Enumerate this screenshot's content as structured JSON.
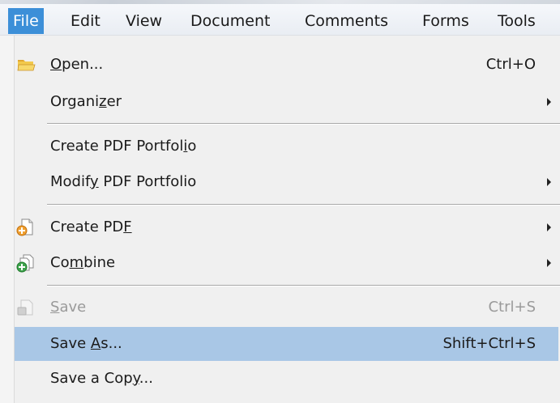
{
  "menubar": {
    "items": [
      {
        "label": "File",
        "active": true
      },
      {
        "label": "Edit"
      },
      {
        "label": "View"
      },
      {
        "label": "Document"
      },
      {
        "label": "Comments"
      },
      {
        "label": "Forms"
      },
      {
        "label": "Tools"
      }
    ]
  },
  "file_menu": {
    "open": {
      "label_pre": "",
      "label_u": "O",
      "label_post": "pen...",
      "shortcut": "Ctrl+O",
      "icon": "folder-open-icon"
    },
    "organizer": {
      "label_pre": "Organi",
      "label_u": "z",
      "label_post": "er",
      "submenu": true
    },
    "create_portfolio": {
      "label_pre": "Create PDF Portfol",
      "label_u": "i",
      "label_post": "o"
    },
    "modify_portfolio": {
      "label_pre": "Modif",
      "label_u": "y",
      "label_post": " PDF Portfolio",
      "submenu": true
    },
    "create_pdf": {
      "label_pre": "Create PD",
      "label_u": "F",
      "label_post": "",
      "submenu": true,
      "icon": "create-pdf-icon"
    },
    "combine": {
      "label_pre": "Co",
      "label_u": "m",
      "label_post": "bine",
      "submenu": true,
      "icon": "combine-icon"
    },
    "save": {
      "label_pre": "",
      "label_u": "S",
      "label_post": "ave",
      "shortcut": "Ctrl+S",
      "disabled": true,
      "icon": "save-icon"
    },
    "save_as": {
      "label_pre": "Save ",
      "label_u": "A",
      "label_post": "s...",
      "shortcut": "Shift+Ctrl+S",
      "selected": true
    },
    "save_copy": {
      "label_pre": "Save a Cop",
      "label_u": "y",
      "label_post": "..."
    }
  },
  "colors": {
    "menu_active_bg": "#3c8fd8",
    "selected_item_bg": "#a9c7e6",
    "disabled_text": "#9a9a9a"
  }
}
